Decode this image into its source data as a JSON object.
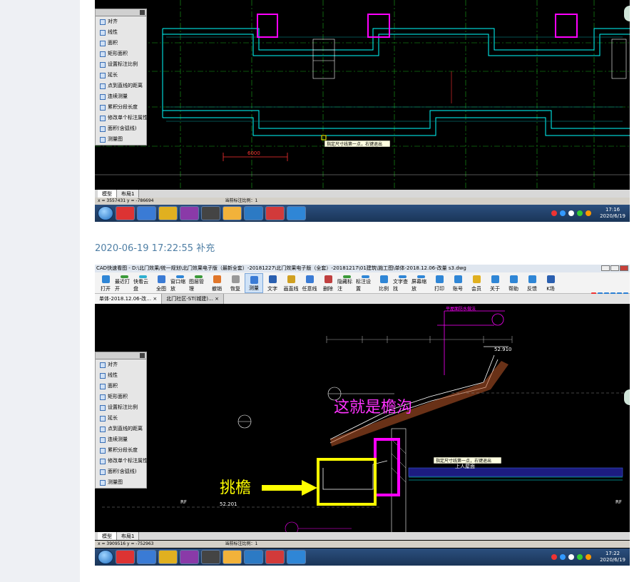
{
  "caption": "2020-06-19 17:22:55 补充",
  "toolbox": {
    "items": [
      "对齐",
      "线性",
      "面积",
      "矩形面积",
      "设置标注比例",
      "延长",
      "点到直线的距离",
      "连续测量",
      "累积分段长度",
      "修改单个标注属性",
      "面积(含弧线)",
      "测量图"
    ]
  },
  "shot1": {
    "tabs": [
      "模型",
      "布局1"
    ],
    "status_coords": "x = 3557431  y = -786694",
    "status_scale": "当前标注比例：1",
    "clock_time": "17:16",
    "clock_date": "2020/6/19",
    "drawing_texts": {
      "dim_6000": "6000",
      "note": "指定尺寸线第一点，右键退出"
    }
  },
  "shot2": {
    "title": "CAD快速看图 - D:\\北门效果/统一规划\\北门效果电子版（最新全套）-20181227\\北门效果电子版（全套）-20181217\\01建筑\\施工图\\单体-2018.12.06-改量 s3.dwg",
    "ribbon": [
      "打开",
      "最近打开",
      "快看云盘",
      "全图",
      "窗口缩放",
      "图层管理",
      "撤销",
      "恢复",
      "测量",
      "文字",
      "画直线",
      "任意线",
      "删除",
      "隐藏标注",
      "标注设置",
      "比例",
      "文字查找",
      "屏幕缩放",
      "打印",
      "账号",
      "会员",
      "关于",
      "帮助",
      "反馈",
      "K场"
    ],
    "doc_tabs": [
      "单体-2018.12.06-改… ×",
      "北门社区-ST(城建)… ×"
    ],
    "tabs": [
      "模型",
      "布局1"
    ],
    "status_coords": "x = 3909516  y = -752963",
    "status_scale": "当前标注比例：1",
    "clock_time": "17:22",
    "clock_date": "2020/6/19",
    "annotations": {
      "gutter": "这就是檐沟",
      "eave": "挑檐"
    },
    "drawing_texts": {
      "note": "指定尺寸线第一点，右键退出",
      "elev_left": "52.201",
      "elev_right": "52.910",
      "roof_note": "上人屋面",
      "top_note": "平屋面防水做法",
      "rf_left": "RF",
      "rf_right": "RF"
    }
  },
  "taskbar": {
    "apps": [
      "IE",
      "Chrome",
      "VS",
      "Explorer",
      "WinRAR",
      "Clip",
      "Note",
      "CAD",
      "Netease",
      "T"
    ]
  },
  "colors": {
    "cad_bg": "#000000",
    "magenta": "#ff00ff",
    "yellow": "#ffff00",
    "cyan": "#00ffff",
    "caption": "#4f7fa5"
  }
}
